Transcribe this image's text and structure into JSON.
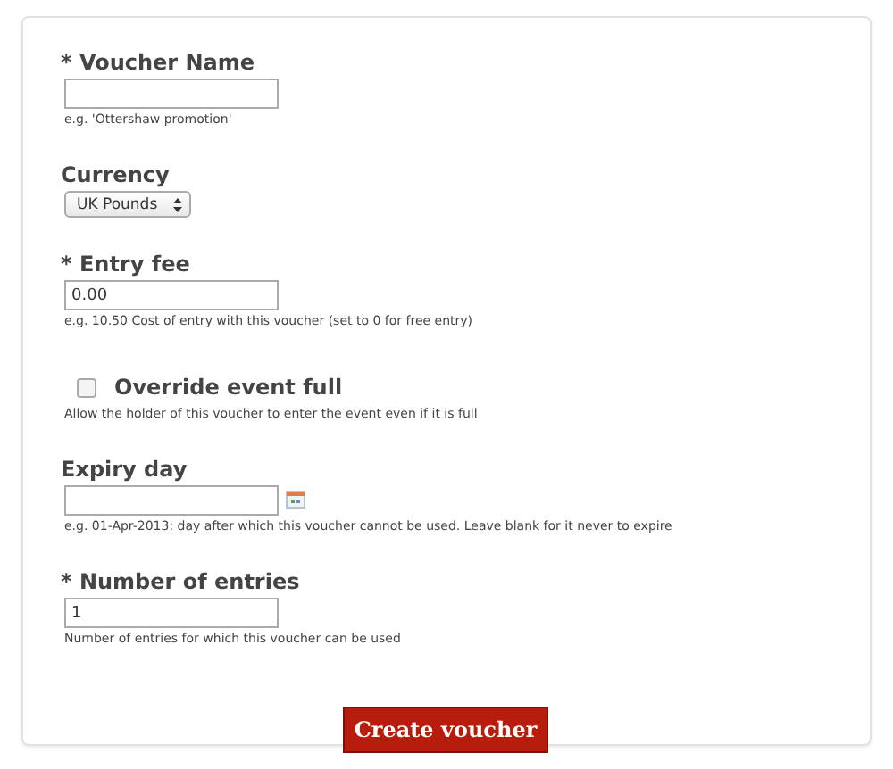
{
  "fields": [
    {
      "kind": "text",
      "label": "* Voucher Name",
      "help": "e.g. 'Ottershaw promotion'"
    },
    {
      "kind": "select",
      "label": "Currency",
      "value": "UK Pounds"
    },
    {
      "kind": "text",
      "label": "* Entry fee",
      "value": "0.00",
      "help": "e.g. 10.50 Cost of entry with this voucher (set to 0 for free entry)"
    },
    {
      "kind": "checkbox",
      "label": "Override event full",
      "checked": false,
      "help": "Allow the holder of this voucher to enter the event even if it is full"
    },
    {
      "kind": "date",
      "label": "Expiry day",
      "help": "e.g. 01-Apr-2013: day after which this voucher cannot be used. Leave blank for it never to expire"
    },
    {
      "kind": "text",
      "label": "* Number of entries",
      "value": "1",
      "help": "Number of entries for which this voucher can be used"
    }
  ],
  "submit": "Create voucher"
}
